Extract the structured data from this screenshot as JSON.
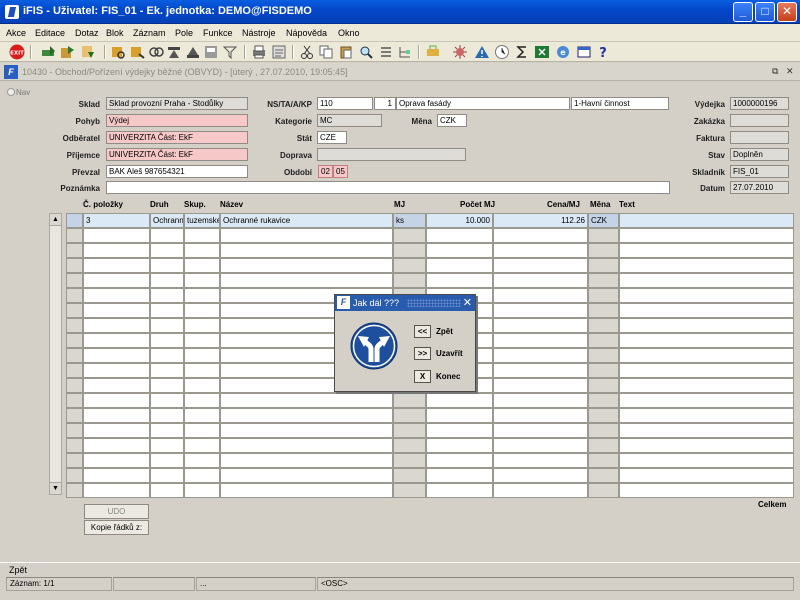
{
  "window": {
    "title": "iFIS - Uživatel: FIS_01 - Ek. jednotka: DEMO@FISDEMO"
  },
  "menu": [
    "Akce",
    "Editace",
    "Dotaz",
    "Blok",
    "Záznam",
    "Pole",
    "Funkce",
    "Nástroje",
    "Nápověda",
    "Okno"
  ],
  "toolbar": {
    "exit_label": "EXIT"
  },
  "form_window": {
    "title": "10430 - Obchod/Pořízení výdejky běžné (OBVYD) - [úterý , 27.07.2010, 19:05:45]"
  },
  "nav_label": "Nav",
  "form": {
    "sklad_label": "Sklad",
    "sklad": "Sklad provozní Praha - Stodůlky",
    "pohyb_label": "Pohyb",
    "pohyb": "Výdej",
    "odberatel_label": "Odběratel",
    "odberatel": "UNIVERZITA Část: EkF",
    "prijemce_label": "Příjemce",
    "prijemce": "UNIVERZITA Část: EkF",
    "prevzal_label": "Převzal",
    "prevzal": "BAK Aleš 987654321",
    "poznamka_label": "Poznámka",
    "poznamka": "",
    "ns_label": "NS/TA/A/KP",
    "ns": "110",
    "ta": "1",
    "akce": "Oprava fasády",
    "kp": "1-Havní činnost",
    "kategorie_label": "Kategorie",
    "kategorie": "MC",
    "mena_label": "Měna",
    "mena": "CZK",
    "stat_label": "Stát",
    "stat": "CZE",
    "doprava_label": "Doprava",
    "doprava": "",
    "obdobi_label": "Období",
    "obdobi_a": "02",
    "obdobi_b": "05",
    "vydejka_label": "Výdejka",
    "vydejka": "1000000196",
    "zakazka_label": "Zakázka",
    "zakazka": "",
    "faktura_label": "Faktura",
    "faktura": "",
    "stav_label": "Stav",
    "stav": "Doplněn",
    "skladnik_label": "Skladník",
    "skladnik": "FIS_01",
    "datum_label": "Datum",
    "datum": "27.07.2010"
  },
  "grid": {
    "columns": [
      "Č. položky",
      "Druh",
      "Skup.",
      "Název",
      "MJ",
      "Počet MJ",
      "Cena/MJ",
      "Měna",
      "Text"
    ],
    "rows": [
      [
        "3",
        "Ochranné",
        "tuzemské",
        "Ochranné rukavice",
        "ks",
        "10.000",
        "112.26",
        "CZK",
        ""
      ]
    ],
    "empty_rows": 18
  },
  "celkem_label": "Celkem",
  "buttons": {
    "udo": "UDO",
    "kopie": "Kopie řádků z:"
  },
  "dialog": {
    "title": "Jak dál ???",
    "options": [
      {
        "key": "<<",
        "label": "Zpět"
      },
      {
        "key": ">>",
        "label": "Uzavřít"
      },
      {
        "key": "X",
        "label": "Konec"
      }
    ]
  },
  "status": {
    "message": "Zpět",
    "record": "Záznam: 1/1",
    "seg3": "...",
    "osc": "<OSC>"
  }
}
